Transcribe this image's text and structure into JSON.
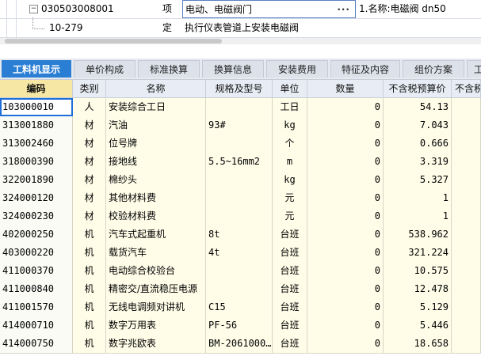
{
  "tree": {
    "rows": [
      {
        "code": "030503008001",
        "type": "项",
        "desc": "电动、电磁阀门",
        "more": "···",
        "feature": "1.名称:电磁阀 dn50",
        "expander": "−"
      },
      {
        "code": "10-279",
        "type": "定",
        "desc": "执行仪表管道上安装电磁阀"
      }
    ]
  },
  "tabs": [
    "工料机显示",
    "单价构成",
    "标准换算",
    "换算信息",
    "安装费用",
    "特征及内容",
    "组价方案",
    "工"
  ],
  "table": {
    "headers": [
      "编码",
      "类别",
      "名称",
      "规格及型号",
      "单位",
      "数量",
      "不含税预算价",
      "不含税"
    ],
    "rows": [
      {
        "code": "103000010",
        "cat": "人",
        "name": "安装综合工日",
        "spec": "",
        "unit": "工日",
        "qty": "0",
        "price": "54.13"
      },
      {
        "code": "313001880",
        "cat": "材",
        "name": "汽油",
        "spec": "93#",
        "unit": "kg",
        "qty": "0",
        "price": "7.043"
      },
      {
        "code": "313002460",
        "cat": "材",
        "name": "位号牌",
        "spec": "",
        "unit": "个",
        "qty": "0",
        "price": "0.666"
      },
      {
        "code": "318000390",
        "cat": "材",
        "name": "接地线",
        "spec": "5.5~16mm2",
        "unit": "m",
        "qty": "0",
        "price": "3.319"
      },
      {
        "code": "322001890",
        "cat": "材",
        "name": "棉纱头",
        "spec": "",
        "unit": "kg",
        "qty": "0",
        "price": "5.327"
      },
      {
        "code": "324000120",
        "cat": "材",
        "name": "其他材料费",
        "spec": "",
        "unit": "元",
        "qty": "0",
        "price": "1"
      },
      {
        "code": "324000230",
        "cat": "材",
        "name": "校验材料费",
        "spec": "",
        "unit": "元",
        "qty": "0",
        "price": "1"
      },
      {
        "code": "402000250",
        "cat": "机",
        "name": "汽车式起重机",
        "spec": "8t",
        "unit": "台班",
        "qty": "0",
        "price": "538.962"
      },
      {
        "code": "403000220",
        "cat": "机",
        "name": "载货汽车",
        "spec": "4t",
        "unit": "台班",
        "qty": "0",
        "price": "321.224"
      },
      {
        "code": "411000370",
        "cat": "机",
        "name": "电动综合校验台",
        "spec": "",
        "unit": "台班",
        "qty": "0",
        "price": "10.575"
      },
      {
        "code": "411000840",
        "cat": "机",
        "name": "精密交/直流稳压电源",
        "spec": "",
        "unit": "台班",
        "qty": "0",
        "price": "12.478"
      },
      {
        "code": "411001570",
        "cat": "机",
        "name": "无线电调频对讲机",
        "spec": "C15",
        "unit": "台班",
        "qty": "0",
        "price": "5.129"
      },
      {
        "code": "414000710",
        "cat": "机",
        "name": "数字万用表",
        "spec": "PF-56",
        "unit": "台班",
        "qty": "0",
        "price": "5.446"
      },
      {
        "code": "414000750",
        "cat": "机",
        "name": "数字兆欧表",
        "spec": "BM-2061000…",
        "unit": "台班",
        "qty": "0",
        "price": "18.658"
      }
    ]
  }
}
